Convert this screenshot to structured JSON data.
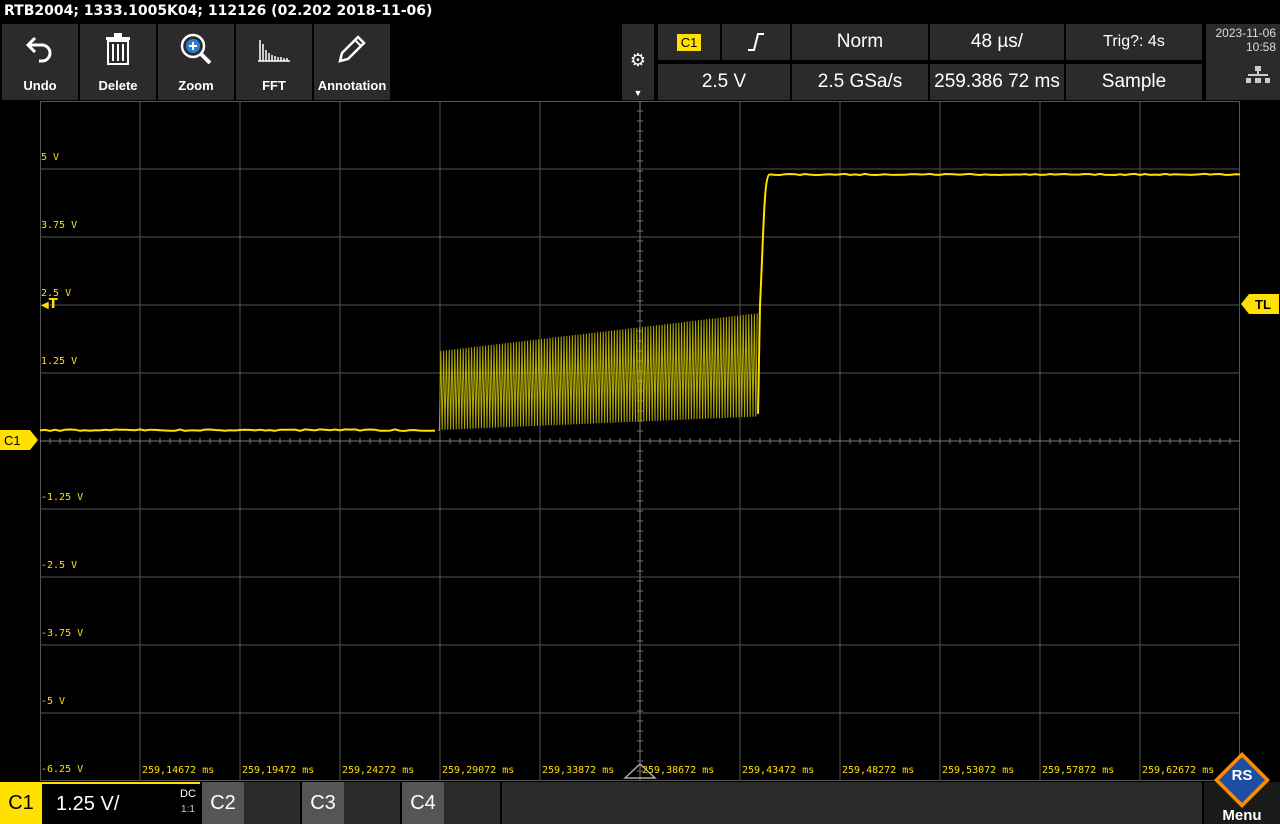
{
  "title": "RTB2004; 1333.1005K04; 112126 (02.202 2018-11-06)",
  "toolbar": {
    "undo": "Undo",
    "delete": "Delete",
    "zoom": "Zoom",
    "fft": "FFT",
    "annotation": "Annotation"
  },
  "status": {
    "trigger_source": "C1",
    "trigger_mode": "Norm",
    "timebase": "48 µs/",
    "trig_status": "Trig?: 4s",
    "trigger_level": "2.5 V",
    "sample_rate": "2.5 GSa/s",
    "position": "259.386 72 ms",
    "acquisition": "Sample",
    "date": "2023-11-06",
    "time": "10:58"
  },
  "axes": {
    "y_labels": [
      "5 V",
      "3.75 V",
      "2.5 V",
      "1.25 V",
      "-1.25 V",
      "-2.5 V",
      "-3.75 V",
      "-5 V",
      "-6.25 V"
    ],
    "x_labels": [
      "259,14672 ms",
      "259,19472 ms",
      "259,24272 ms",
      "259,29072 ms",
      "259,33872 ms",
      "259,38672 ms",
      "259,43472 ms",
      "259,48272 ms",
      "259,53072 ms",
      "259,57872 ms",
      "259,62672 ms"
    ]
  },
  "markers": {
    "channel": "C1",
    "trigger_level": "TL",
    "trigger_arrow": "T"
  },
  "channels": {
    "c1": "C1",
    "c1_scale": "1.25 V/",
    "c1_coupling": "DC",
    "c1_ratio": "1:1",
    "c2": "C2",
    "c3": "C3",
    "c4": "C4"
  },
  "menu_label": "Menu",
  "logo_text": "RS",
  "colors": {
    "trace": "#ffe000",
    "grid": "#555555",
    "panel": "#2b2b2b"
  }
}
